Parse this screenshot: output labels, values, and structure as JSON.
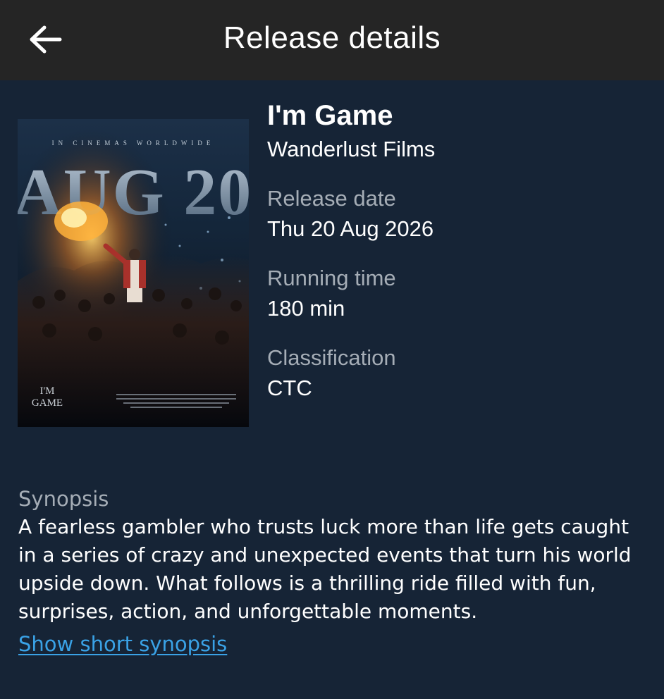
{
  "header": {
    "back_icon": "arrow-left-icon",
    "title": "Release details"
  },
  "movie": {
    "title": "I'm Game",
    "distributor": "Wanderlust Films",
    "poster": {
      "top_text": "IN CINEMAS WORLDWIDE",
      "date_text": "AUG 20",
      "logo_line1": "I'M",
      "logo_line2": "GAME"
    },
    "details": [
      {
        "label": "Release date",
        "value": "Thu 20 Aug 2026"
      },
      {
        "label": "Running time",
        "value": "180 min"
      },
      {
        "label": "Classification",
        "value": "CTC"
      }
    ]
  },
  "synopsis": {
    "label": "Synopsis",
    "text": "A fearless gambler who trusts luck more than life gets caught in a series of crazy and unexpected events that turn his world upside down. What follows is a thrilling ride filled with fun, surprises, action, and unforgettable moments.",
    "toggle_link": "Show short synopsis"
  },
  "colors": {
    "header_bg": "#252525",
    "page_bg": "#162436",
    "label": "#a5adb6",
    "link": "#3aa2e6"
  }
}
